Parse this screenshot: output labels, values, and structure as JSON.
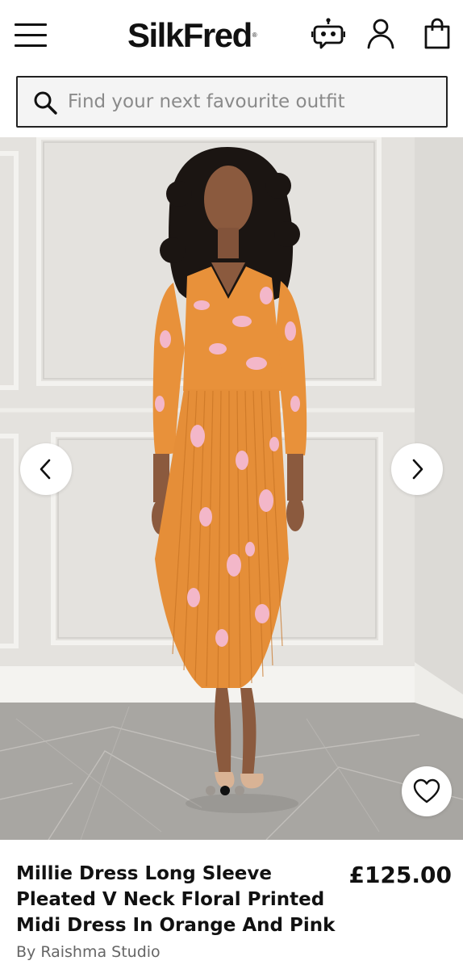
{
  "header": {
    "logo": "SilkFred",
    "logo_mark": "®"
  },
  "search": {
    "placeholder": "Find your next favourite outfit"
  },
  "gallery": {
    "image_count": 3,
    "active_index": 1
  },
  "product": {
    "title": "Millie Dress Long Sleeve Pleated V Neck Floral Printed Midi Dress In Orange And Pink",
    "price": "£125.00",
    "brand": "By Raishma Studio"
  },
  "icons": {
    "menu": "hamburger-menu-icon",
    "assistant": "robot-chat-icon",
    "account": "user-icon",
    "bag": "shopping-bag-icon",
    "search": "search-icon",
    "prev": "chevron-left-icon",
    "next": "chevron-right-icon",
    "favourite": "heart-icon"
  },
  "colors": {
    "dress_orange": "#e8913a",
    "dress_pink": "#f3b7c9",
    "wall": "#e3e1dd",
    "floor": "#a9a7a4",
    "text": "#111111",
    "muted": "#666666"
  }
}
